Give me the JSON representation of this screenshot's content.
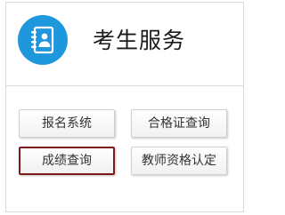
{
  "header": {
    "title": "考生服务",
    "icon": "contact-book-icon",
    "icon_color": "#1f97dc"
  },
  "buttons": [
    {
      "label": "报名系统",
      "highlighted": false
    },
    {
      "label": "合格证查询",
      "highlighted": false
    },
    {
      "label": "成绩查询",
      "highlighted": true
    },
    {
      "label": "教师资格认定",
      "highlighted": false
    }
  ],
  "colors": {
    "highlight_border": "#7a1c1c"
  }
}
